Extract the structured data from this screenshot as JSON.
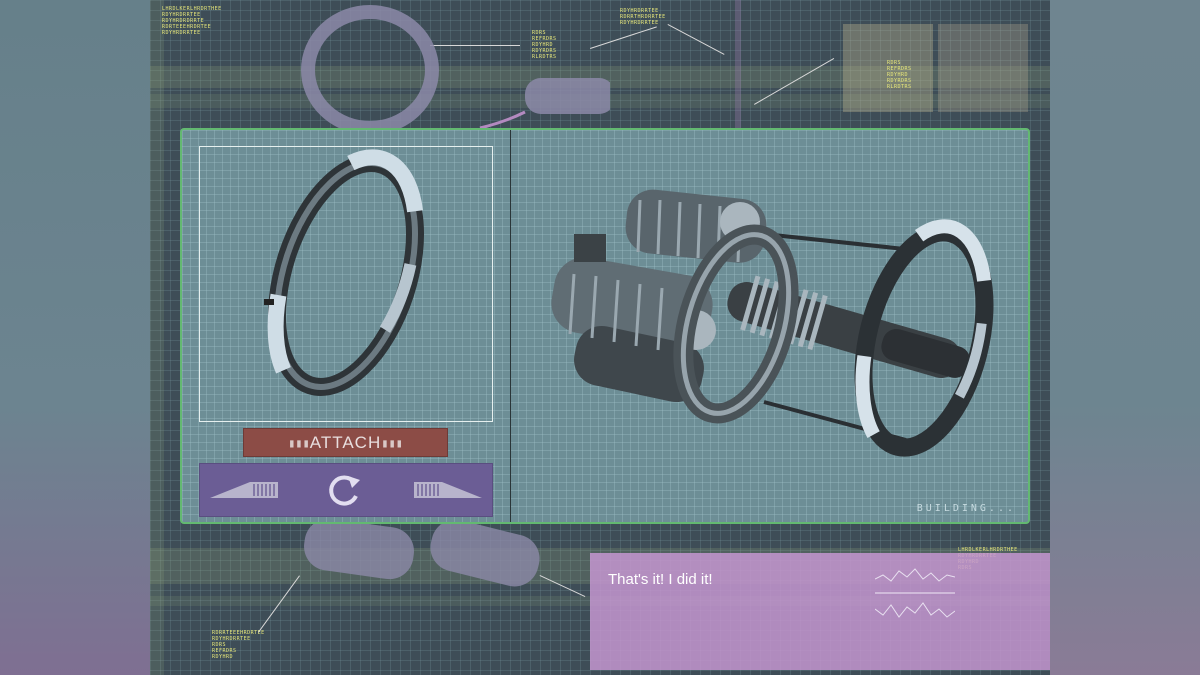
{
  "panel": {
    "attach_label": "ATTACH",
    "status": "BUILDING..."
  },
  "dialogue": {
    "text": "That's it! I did it!"
  },
  "colors": {
    "frame_border": "#63b971",
    "attach_button": "#8c4c46",
    "control_bar": "#6b5d95",
    "dialogue_box": "#c496d0",
    "panel_bg": "#6d8e96"
  },
  "icons": [
    "rotate-icon",
    "left-arrow-icon",
    "right-arrow-icon"
  ]
}
